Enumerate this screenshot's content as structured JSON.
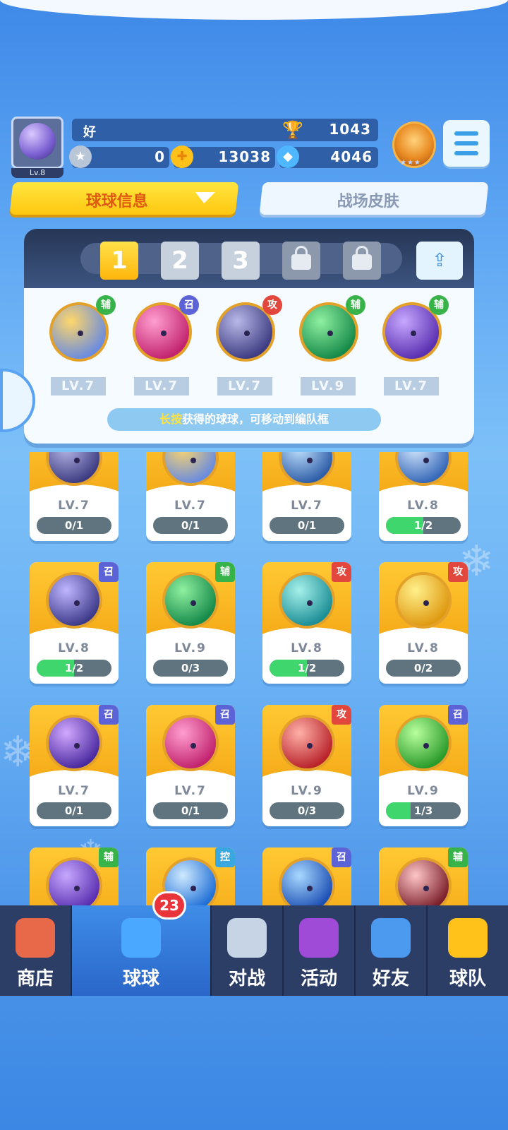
{
  "player": {
    "name": "好",
    "level": "Lv.8",
    "trophies": "1043"
  },
  "currency": {
    "stars": "0",
    "coins": "13038",
    "gems": "4046"
  },
  "tabs": {
    "info": "球球信息",
    "skins": "战场皮肤"
  },
  "team_slots": [
    "1",
    "2",
    "3"
  ],
  "team": [
    {
      "badge": "辅",
      "lv": "LV.7",
      "color1": "#ffd76a",
      "color2": "#6a8ce0"
    },
    {
      "badge": "召",
      "lv": "LV.7",
      "color1": "#ff9ed0",
      "color2": "#c2236e"
    },
    {
      "badge": "攻",
      "lv": "LV.7",
      "color1": "#b9b8e8",
      "color2": "#3d3c82"
    },
    {
      "badge": "辅",
      "lv": "LV.9",
      "color1": "#8ff0a0",
      "color2": "#168a4a"
    },
    {
      "badge": "辅",
      "lv": "LV.7",
      "color1": "#c6a8ff",
      "color2": "#5a2fb0"
    }
  ],
  "hint": {
    "highlight": "长按",
    "text": "获得的球球，可移动到编队框"
  },
  "collection": [
    {
      "badge": "",
      "lv": "LV.7",
      "progress": "0/1",
      "fill": 0,
      "color1": "#b9b8e8",
      "color2": "#3d3c82"
    },
    {
      "badge": "",
      "lv": "LV.7",
      "progress": "0/1",
      "fill": 0,
      "color1": "#ffd76a",
      "color2": "#6a8ce0"
    },
    {
      "badge": "",
      "lv": "LV.7",
      "progress": "0/1",
      "fill": 0,
      "color1": "#c3e4ff",
      "color2": "#2f5ea8"
    },
    {
      "badge": "",
      "lv": "LV.8",
      "progress": "1/2",
      "fill": 0.5,
      "color1": "#d6e9ff",
      "color2": "#3668b8"
    },
    {
      "badge": "召",
      "lv": "LV.8",
      "progress": "1/2",
      "fill": 0.5,
      "color1": "#c0b6ff",
      "color2": "#3d3a8a"
    },
    {
      "badge": "辅",
      "lv": "LV.9",
      "progress": "0/3",
      "fill": 0,
      "color1": "#8ff0a0",
      "color2": "#168a4a"
    },
    {
      "badge": "攻",
      "lv": "LV.8",
      "progress": "1/2",
      "fill": 0.5,
      "color1": "#a6f1ea",
      "color2": "#1c8e96"
    },
    {
      "badge": "攻",
      "lv": "LV.8",
      "progress": "0/2",
      "fill": 0,
      "color1": "#fff08a",
      "color2": "#e09a12"
    },
    {
      "badge": "召",
      "lv": "LV.7",
      "progress": "0/1",
      "fill": 0,
      "color1": "#d2a8ff",
      "color2": "#4a2aa0"
    },
    {
      "badge": "召",
      "lv": "LV.7",
      "progress": "0/1",
      "fill": 0,
      "color1": "#ff9ed0",
      "color2": "#c2236e"
    },
    {
      "badge": "攻",
      "lv": "LV.9",
      "progress": "0/3",
      "fill": 0,
      "color1": "#ffb0a8",
      "color2": "#b8232a"
    },
    {
      "badge": "召",
      "lv": "LV.9",
      "progress": "1/3",
      "fill": 0.33,
      "color1": "#b8ff9c",
      "color2": "#2a9a2a"
    },
    {
      "badge": "辅",
      "lv": "",
      "progress": "",
      "fill": 0,
      "color1": "#c6a8ff",
      "color2": "#5a2fb0"
    },
    {
      "badge": "控",
      "lv": "",
      "progress": "",
      "fill": 0,
      "color1": "#cfeaff",
      "color2": "#1f6fd6"
    },
    {
      "badge": "召",
      "lv": "",
      "progress": "",
      "fill": 0,
      "color1": "#a8d8ff",
      "color2": "#1c4fb4"
    },
    {
      "badge": "辅",
      "lv": "",
      "progress": "",
      "fill": 0,
      "color1": "#ffc6c6",
      "color2": "#7a1e2a"
    }
  ],
  "nav": [
    {
      "label": "商店",
      "icon": "shop-icon"
    },
    {
      "label": "球球",
      "icon": "balls-icon"
    },
    {
      "label": "对战",
      "icon": "swords-icon"
    },
    {
      "label": "活动",
      "icon": "party-popper-icon"
    },
    {
      "label": "好友",
      "icon": "friends-icon"
    },
    {
      "label": "球队",
      "icon": "whistle-icon"
    }
  ],
  "nav_badge": "23"
}
